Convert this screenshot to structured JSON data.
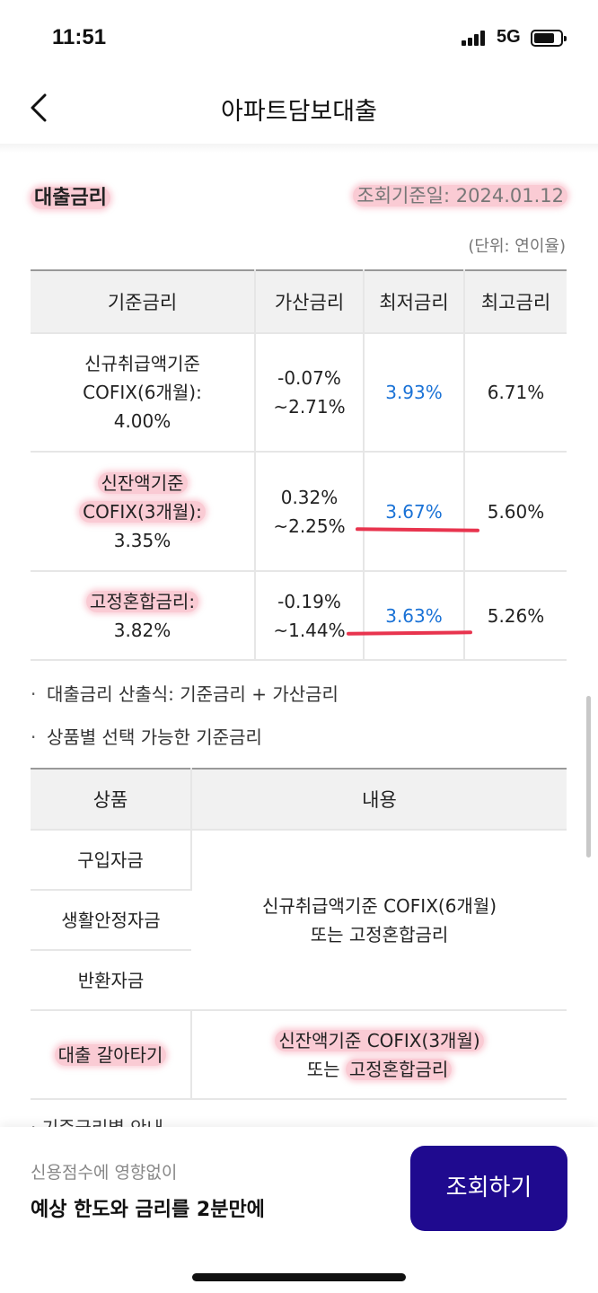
{
  "status_bar": {
    "time": "11:51",
    "network": "5G",
    "icons": [
      "signal-icon",
      "battery-icon"
    ]
  },
  "nav": {
    "back_icon": "chevron-left-icon",
    "title": "아파트담보대출"
  },
  "loan_rate": {
    "section_title": "대출금리",
    "query_date": "조회기준일: 2024.01.12",
    "unit_note": "(단위: 연이율)",
    "headers": [
      "기준금리",
      "가산금리",
      "최저금리",
      "최고금리"
    ],
    "rows": [
      {
        "base_line1": "신규취급액기준",
        "base_line2": "COFIX(6개월):",
        "base_line3": "4.00%",
        "spread_line1": "-0.07%",
        "spread_line2": "~2.71%",
        "min": "3.93%",
        "max": "6.71%"
      },
      {
        "base_line1": "신잔액기준",
        "base_line2": "COFIX(3개월):",
        "base_line3": "3.35%",
        "spread_line1": "0.32%",
        "spread_line2": "~2.25%",
        "min": "3.67%",
        "max": "5.60%"
      },
      {
        "base_line1": "고정혼합금리:",
        "base_line2": "3.82%",
        "spread_line1": "-0.19%",
        "spread_line2": "~1.44%",
        "min": "3.63%",
        "max": "5.26%"
      }
    ],
    "accent_color": "#1a72d6",
    "highlight_color": "#f48ca0",
    "underline_color": "#e8344e"
  },
  "notes": {
    "bullet": "·",
    "formula": "대출금리 산출식: 기준금리 + 가산금리",
    "selectable": "상품별 선택 가능한 기준금리"
  },
  "product_table": {
    "headers": [
      "상품",
      "내용"
    ],
    "products": [
      "구입자금",
      "생활안정자금",
      "반환자금",
      "대출 갈아타기"
    ],
    "content_group_line1": "신규취급액기준 COFIX(6개월)",
    "content_group_line2": "또는 고정혼합금리",
    "content_refi_line1": "신잔액기준 COFIX(3개월)",
    "content_refi_line2_prefix": "또는 ",
    "content_refi_line2_hl": "고정혼합금리"
  },
  "cut_off_text": "· 기준금리별 안내",
  "bottom_cta": {
    "sub_text": "신용점수에 영향없이",
    "main_text": "예상 한도와 금리를 2분만에",
    "button_label": "조회하기",
    "button_color": "#1f0a8f"
  }
}
